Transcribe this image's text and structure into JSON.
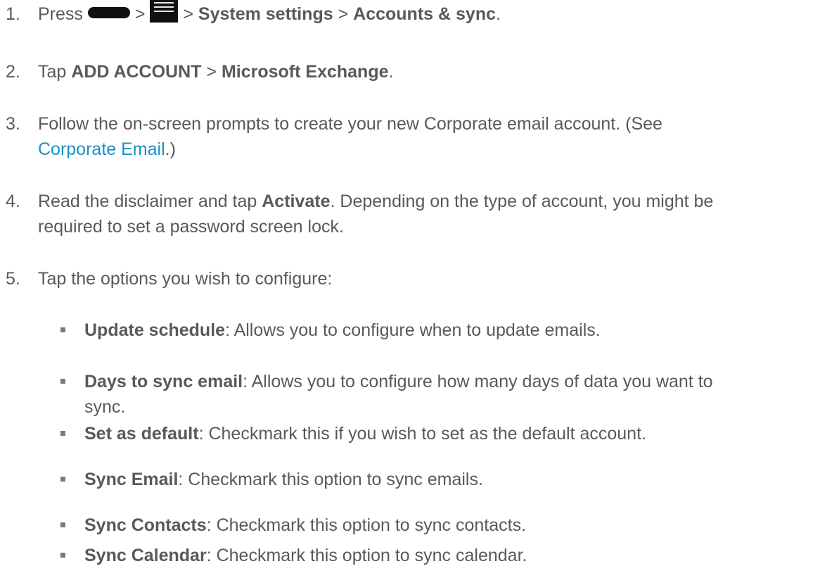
{
  "steps": [
    {
      "num": "1.",
      "press": "Press",
      "gt": ">",
      "system_settings": "System settings",
      "accounts_sync": "Accounts & sync",
      "end": "."
    },
    {
      "num": "2.",
      "tap": "Tap",
      "add_account": "ADD ACCOUNT",
      "gt": ">",
      "microsoft_exchange": "Microsoft Exchange",
      "end": "."
    },
    {
      "num": "3.",
      "line1": "Follow the on-screen prompts to create your new Corporate email account. (See",
      "link": "Corporate Email",
      "after": ".)"
    },
    {
      "num": "4.",
      "pre": "Read the disclaimer and tap",
      "activate": "Activate",
      "post": ". Depending on the type of account, you might be",
      "line2": "required to set a password screen lock."
    },
    {
      "num": "5.",
      "text": "Tap the options you wish to configure:"
    }
  ],
  "options": [
    {
      "term": "Update schedule",
      "desc": ": Allows you to configure when to update emails."
    },
    {
      "term": "Days to sync email",
      "desc": ": Allows you to configure how many days of data you want to",
      "desc2": "sync."
    },
    {
      "term": "Set as default",
      "desc": ": Checkmark this if you wish to set as the default account."
    },
    {
      "term": "Sync Email",
      "desc": ": Checkmark this option to sync emails."
    },
    {
      "term": "Sync Contacts",
      "desc": ": Checkmark this option to sync contacts."
    },
    {
      "term": "Sync Calendar",
      "desc": ": Checkmark this option to sync calendar."
    }
  ],
  "icons": {
    "power": "power-button-icon",
    "menu": "menu-icon"
  },
  "colors": {
    "text": "#595959",
    "link": "#1a8fc7"
  }
}
